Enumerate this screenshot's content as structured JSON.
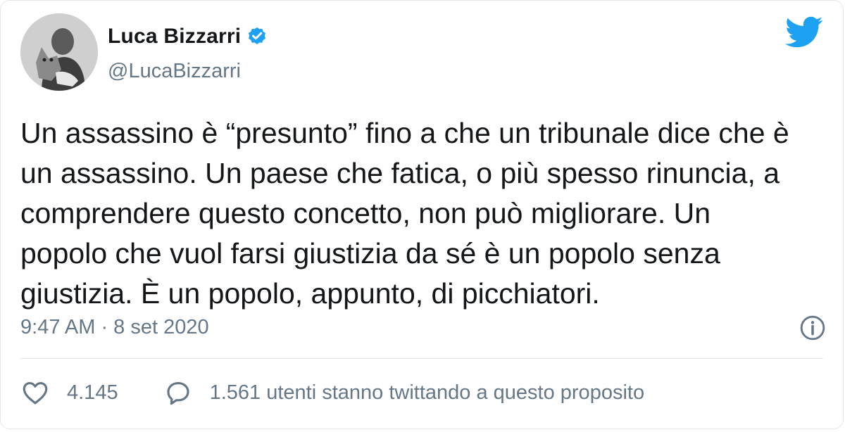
{
  "author": {
    "name": "Luca Bizzarri",
    "handle": "@LucaBizzarri",
    "verified": true
  },
  "tweet": {
    "text": "Un assassino è “presunto” fino a che un tribunale dice che è\nun assassino. Un paese che fatica, o più spesso rinuncia, a\ncomprendere questo concetto, non può migliorare. Un\npopolo che vuol farsi giustizia da sé è un popolo senza\ngiustizia. È un popolo, appunto, di picchiatori.",
    "timestamp": "9:47 AM · 8 set 2020"
  },
  "actions": {
    "likes": "4.145",
    "replies_text": "1.561 utenti stanno twittando a questo proposito"
  },
  "icons": {
    "brand": "twitter-bird-icon",
    "verified": "verified-badge-icon",
    "info": "info-icon",
    "like": "heart-icon",
    "reply": "speech-bubble-icon"
  },
  "colors": {
    "brand": "#1da1f2",
    "text": "#14171a",
    "muted": "#657786",
    "border": "#e1e8ed"
  }
}
